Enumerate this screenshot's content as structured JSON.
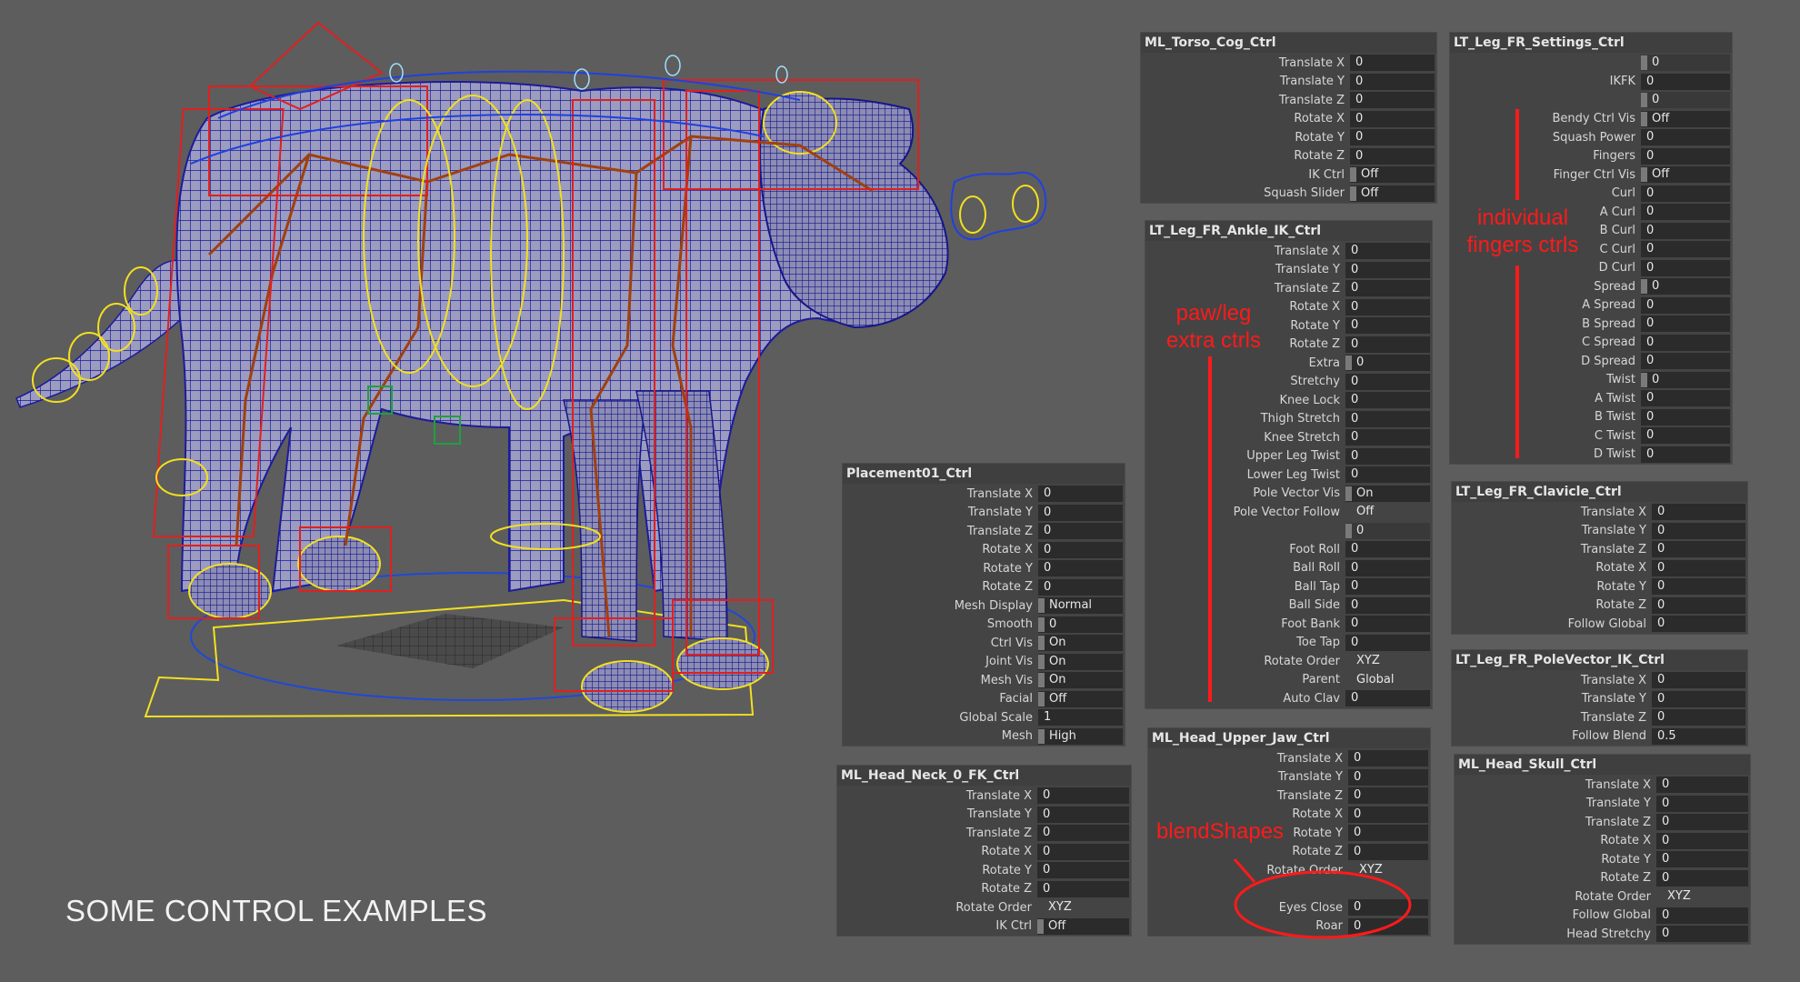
{
  "caption": "SOME CONTROL EXAMPLES",
  "annotations": {
    "paw_leg": [
      "paw/leg",
      "extra ctrls"
    ],
    "fingers": [
      "individual",
      "fingers ctrls"
    ],
    "blendshapes": "blendShapes"
  },
  "colors": {
    "background": "#5d5d5d",
    "panel": "#444444",
    "field": "#2b2b2b",
    "annotation": "#ff1a1a",
    "wireframe": "#1c1c9a",
    "rig_red": "#e02020",
    "rig_yellow": "#f2e020",
    "rig_blue": "#2040e0"
  },
  "panels": {
    "torso_cog": {
      "title": "ML_Torso_Cog_Ctrl",
      "rows": [
        {
          "label": "Translate X",
          "value": "0"
        },
        {
          "label": "Translate Y",
          "value": "0"
        },
        {
          "label": "Translate Z",
          "value": "0"
        },
        {
          "label": "Rotate X",
          "value": "0"
        },
        {
          "label": "Rotate Y",
          "value": "0"
        },
        {
          "label": "Rotate Z",
          "value": "0"
        },
        {
          "label": "IK Ctrl",
          "value": "Off"
        },
        {
          "label": "Squash Slider",
          "value": "Off"
        }
      ]
    },
    "leg_settings": {
      "title": "LT_Leg_FR_Settings_Ctrl",
      "rows": [
        {
          "label": "",
          "value": "0"
        },
        {
          "label": "IKFK",
          "value": "0"
        },
        {
          "label": "",
          "value": "0"
        },
        {
          "label": "Bendy Ctrl Vis",
          "value": "Off"
        },
        {
          "label": "Squash Power",
          "value": "0"
        },
        {
          "label": "Fingers",
          "value": "0"
        },
        {
          "label": "Finger Ctrl Vis",
          "value": "Off"
        },
        {
          "label": "Curl",
          "value": "0"
        },
        {
          "label": "A Curl",
          "value": "0"
        },
        {
          "label": "B Curl",
          "value": "0"
        },
        {
          "label": "C Curl",
          "value": "0"
        },
        {
          "label": "D Curl",
          "value": "0"
        },
        {
          "label": "Spread",
          "value": "0"
        },
        {
          "label": "A Spread",
          "value": "0"
        },
        {
          "label": "B Spread",
          "value": "0"
        },
        {
          "label": "C Spread",
          "value": "0"
        },
        {
          "label": "D Spread",
          "value": "0"
        },
        {
          "label": "Twist",
          "value": "0"
        },
        {
          "label": "A Twist",
          "value": "0"
        },
        {
          "label": "B Twist",
          "value": "0"
        },
        {
          "label": "C Twist",
          "value": "0"
        },
        {
          "label": "D Twist",
          "value": "0"
        }
      ]
    },
    "ankle_ik": {
      "title": "LT_Leg_FR_Ankle_IK_Ctrl",
      "rows": [
        {
          "label": "Translate X",
          "value": "0"
        },
        {
          "label": "Translate Y",
          "value": "0"
        },
        {
          "label": "Translate Z",
          "value": "0"
        },
        {
          "label": "Rotate X",
          "value": "0"
        },
        {
          "label": "Rotate Y",
          "value": "0"
        },
        {
          "label": "Rotate Z",
          "value": "0"
        },
        {
          "label": "Extra",
          "value": "0"
        },
        {
          "label": "Stretchy",
          "value": "0"
        },
        {
          "label": "Knee Lock",
          "value": "0"
        },
        {
          "label": "Thigh Stretch",
          "value": "0"
        },
        {
          "label": "Knee Stretch",
          "value": "0"
        },
        {
          "label": "Upper Leg Twist",
          "value": "0"
        },
        {
          "label": "Lower Leg Twist",
          "value": "0"
        },
        {
          "label": "Pole Vector Vis",
          "value": "On"
        },
        {
          "label": "Pole Vector Follow",
          "value": "Off"
        },
        {
          "label": "",
          "value": "0"
        },
        {
          "label": "Foot Roll",
          "value": "0"
        },
        {
          "label": "Ball Roll",
          "value": "0"
        },
        {
          "label": "Ball Tap",
          "value": "0"
        },
        {
          "label": "Ball Side",
          "value": "0"
        },
        {
          "label": "Foot Bank",
          "value": "0"
        },
        {
          "label": "Toe Tap",
          "value": "0"
        },
        {
          "label": "Rotate Order",
          "value": "XYZ"
        },
        {
          "label": "Parent",
          "value": "Global"
        },
        {
          "label": "Auto Clav",
          "value": "0"
        }
      ]
    },
    "clavicle": {
      "title": "LT_Leg_FR_Clavicle_Ctrl",
      "rows": [
        {
          "label": "Translate X",
          "value": "0"
        },
        {
          "label": "Translate Y",
          "value": "0"
        },
        {
          "label": "Translate Z",
          "value": "0"
        },
        {
          "label": "Rotate X",
          "value": "0"
        },
        {
          "label": "Rotate Y",
          "value": "0"
        },
        {
          "label": "Rotate Z",
          "value": "0"
        },
        {
          "label": "Follow Global",
          "value": "0"
        }
      ]
    },
    "pole_vector": {
      "title": "LT_Leg_FR_PoleVector_IK_Ctrl",
      "rows": [
        {
          "label": "Translate X",
          "value": "0"
        },
        {
          "label": "Translate Y",
          "value": "0"
        },
        {
          "label": "Translate Z",
          "value": "0"
        },
        {
          "label": "Follow Blend",
          "value": "0.5"
        }
      ]
    },
    "placement": {
      "title": "Placement01_Ctrl",
      "rows": [
        {
          "label": "Translate X",
          "value": "0"
        },
        {
          "label": "Translate Y",
          "value": "0"
        },
        {
          "label": "Translate Z",
          "value": "0"
        },
        {
          "label": "Rotate X",
          "value": "0"
        },
        {
          "label": "Rotate Y",
          "value": "0"
        },
        {
          "label": "Rotate Z",
          "value": "0"
        },
        {
          "label": "Mesh Display",
          "value": "Normal"
        },
        {
          "label": "Smooth",
          "value": "0"
        },
        {
          "label": "Ctrl Vis",
          "value": "On"
        },
        {
          "label": "Joint Vis",
          "value": "On"
        },
        {
          "label": "Mesh Vis",
          "value": "On"
        },
        {
          "label": "Facial",
          "value": "Off"
        },
        {
          "label": "Global Scale",
          "value": "1"
        },
        {
          "label": "Mesh",
          "value": "High"
        }
      ]
    },
    "upper_jaw": {
      "title": "ML_Head_Upper_Jaw_Ctrl",
      "rows": [
        {
          "label": "Translate X",
          "value": "0"
        },
        {
          "label": "Translate Y",
          "value": "0"
        },
        {
          "label": "Translate Z",
          "value": "0"
        },
        {
          "label": "Rotate X",
          "value": "0"
        },
        {
          "label": "Rotate Y",
          "value": "0"
        },
        {
          "label": "Rotate Z",
          "value": "0"
        },
        {
          "label": "Rotate Order",
          "value": "XYZ"
        },
        {
          "label": "",
          "value": ""
        },
        {
          "label": "Eyes Close",
          "value": "0"
        },
        {
          "label": "Roar",
          "value": "0"
        }
      ]
    },
    "neck_fk": {
      "title": "ML_Head_Neck_0_FK_Ctrl",
      "rows": [
        {
          "label": "Translate X",
          "value": "0"
        },
        {
          "label": "Translate Y",
          "value": "0"
        },
        {
          "label": "Translate Z",
          "value": "0"
        },
        {
          "label": "Rotate X",
          "value": "0"
        },
        {
          "label": "Rotate Y",
          "value": "0"
        },
        {
          "label": "Rotate Z",
          "value": "0"
        },
        {
          "label": "Rotate Order",
          "value": "XYZ"
        },
        {
          "label": "IK Ctrl",
          "value": "Off"
        }
      ]
    },
    "skull": {
      "title": "ML_Head_Skull_Ctrl",
      "rows": [
        {
          "label": "Translate X",
          "value": "0"
        },
        {
          "label": "Translate Y",
          "value": "0"
        },
        {
          "label": "Translate Z",
          "value": "0"
        },
        {
          "label": "Rotate X",
          "value": "0"
        },
        {
          "label": "Rotate Y",
          "value": "0"
        },
        {
          "label": "Rotate Z",
          "value": "0"
        },
        {
          "label": "Rotate Order",
          "value": "XYZ"
        },
        {
          "label": "Follow Global",
          "value": "0"
        },
        {
          "label": "Head Stretchy",
          "value": "0"
        }
      ]
    }
  }
}
